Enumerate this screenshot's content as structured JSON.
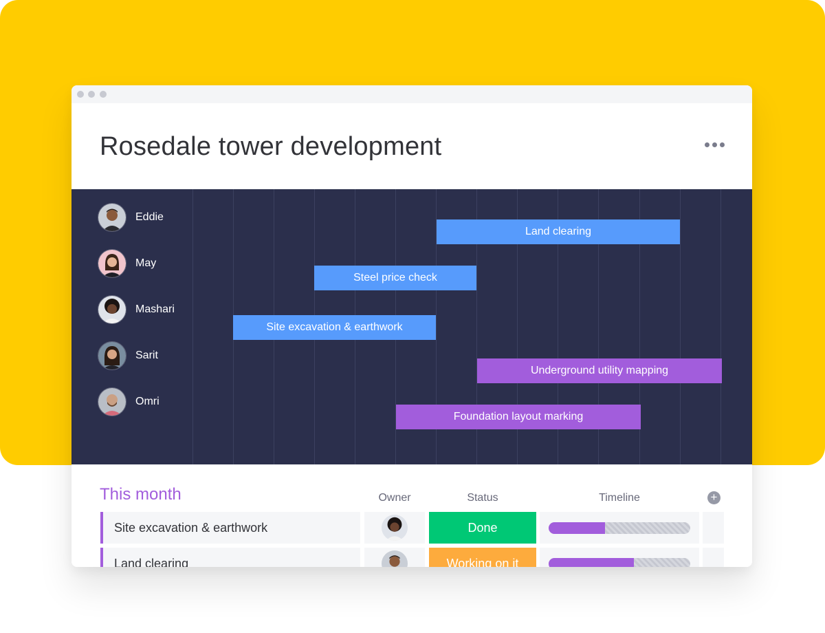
{
  "board": {
    "title": "Rosedale tower development",
    "more_menu_icon": "more-horizontal-icon"
  },
  "gantt": {
    "people": [
      {
        "name": "Eddie"
      },
      {
        "name": "May"
      },
      {
        "name": "Mashari"
      },
      {
        "name": "Sarit"
      },
      {
        "name": "Omri"
      }
    ],
    "tasks": [
      {
        "label": "Land clearing",
        "color": "#579bfc"
      },
      {
        "label": "Steel price check",
        "color": "#579bfc"
      },
      {
        "label": "Site excavation & earthwork",
        "color": "#579bfc"
      },
      {
        "label": "Underground utility mapping",
        "color": "#a25ddc"
      },
      {
        "label": "Foundation layout marking",
        "color": "#a25ddc"
      }
    ]
  },
  "table": {
    "group_title": "This month",
    "group_color": "#a25ddc",
    "columns": {
      "owner": "Owner",
      "status": "Status",
      "timeline": "Timeline"
    },
    "add_column_icon": "plus-circle-icon",
    "rows": [
      {
        "name": "Site excavation & earthwork",
        "status": "Done",
        "status_color": "#00c875",
        "timeline_progress": 0.4
      },
      {
        "name": "Land clearing",
        "status": "Working on it",
        "status_color": "#fdab3d",
        "timeline_progress": 0.6
      }
    ]
  },
  "colors": {
    "background": "#ffcc00",
    "gantt_background": "#2b2f4c",
    "bar_blue": "#579bfc",
    "bar_purple": "#a25ddc"
  }
}
